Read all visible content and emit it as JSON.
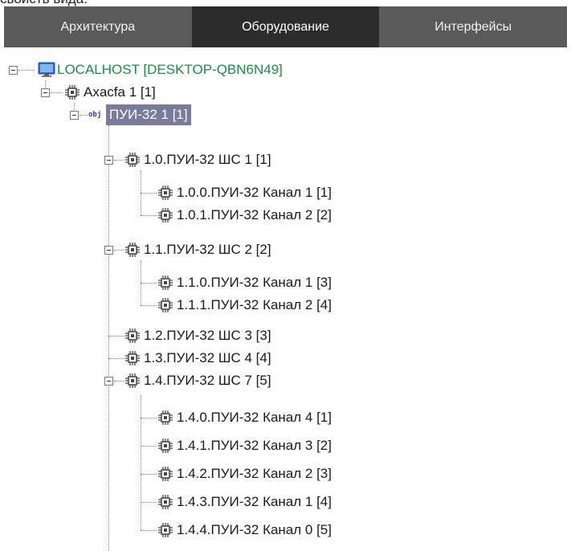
{
  "window": {
    "top_text": "свойств вида."
  },
  "tabs": [
    {
      "label": "Архитектура"
    },
    {
      "label": "Оборудование"
    },
    {
      "label": "Интерфейсы"
    }
  ],
  "tree": {
    "root": "LOCALHOST [DESKTOP-QBN6N49]",
    "axxon": "Axacfa 1 [1]",
    "pui": "ПУИ-32 1 [1]",
    "obj_badge": "obj",
    "items": [
      "1.0.ПУИ-32 ШС 1 [1]",
      "1.0.0.ПУИ-32 Канал 1 [1]",
      "1.0.1.ПУИ-32 Канал 2 [2]",
      "1.1.ПУИ-32 ШС 2 [2]",
      "1.1.0.ПУИ-32 Канал 1 [3]",
      "1.1.1.ПУИ-32 Канал 2 [4]",
      "1.2.ПУИ-32 ШС 3 [3]",
      "1.3.ПУИ-32 ШС 4 [4]",
      "1.4.ПУИ-32 ШС 7 [5]",
      "1.4.0.ПУИ-32 Канал 4 [1]",
      "1.4.1.ПУИ-32 Канал 3 [2]",
      "1.4.2.ПУИ-32 Канал 2 [3]",
      "1.4.3.ПУИ-32 Канал 1 [4]",
      "1.4.4.ПУИ-32 Канал 0 [5]"
    ],
    "icons": {
      "root": "monitor-icon",
      "device": "chip-icon"
    }
  }
}
